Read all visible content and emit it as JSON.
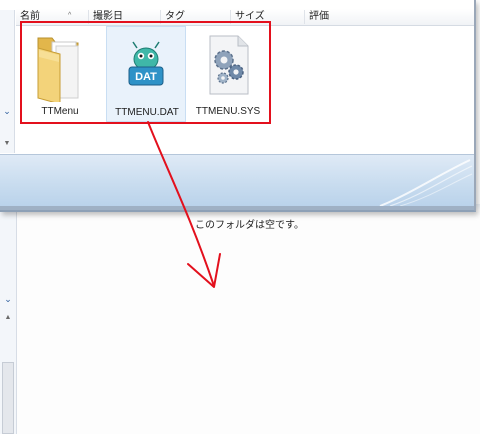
{
  "columns": [
    "名前",
    "撮影日",
    "タグ",
    "サイズ",
    "評価"
  ],
  "files": [
    {
      "name": "TTMenu",
      "icon": "folder-icon"
    },
    {
      "name": "TTMENU.DAT",
      "icon": "dat-file-icon",
      "badge": "DAT"
    },
    {
      "name": "TTMENU.SYS",
      "icon": "system-file-gear-icon"
    }
  ],
  "empty_folder_message": "このフォルダは空です。",
  "annotation": {
    "highlight_color": "#e3101d",
    "arrow_color": "#e3101d"
  }
}
